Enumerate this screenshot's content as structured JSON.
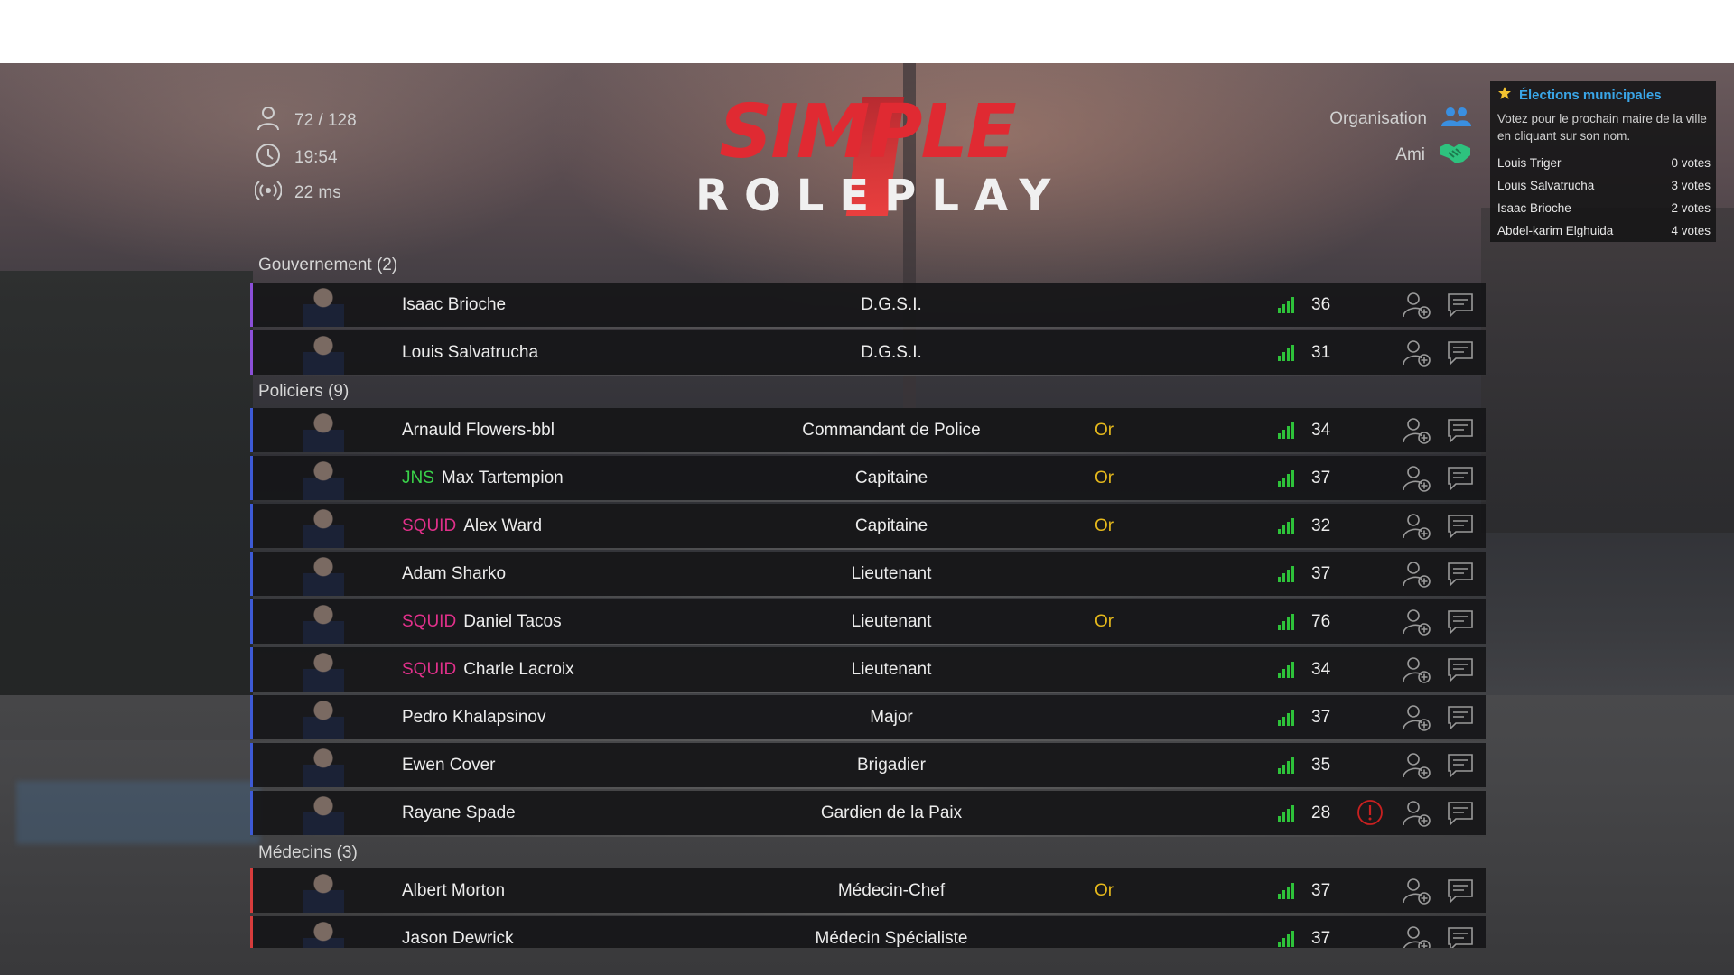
{
  "header": {
    "players": "72 / 128",
    "time": "19:54",
    "ping": "22 ms",
    "icons": {
      "players": "user-icon",
      "time": "clock-icon",
      "ping": "broadcast-icon"
    }
  },
  "logo": {
    "line1": "SIMPLE",
    "line2": "ROLEPLAY"
  },
  "legend": {
    "organisation": "Organisation",
    "ami": "Ami",
    "organisation_color": "#3a8fe0",
    "ami_color": "#2ec27e"
  },
  "elections": {
    "title": "Élections municipales",
    "description": "Votez pour le prochain maire de la ville en cliquant sur son nom.",
    "candidates": [
      {
        "name": "Louis Triger",
        "votes": "0 votes"
      },
      {
        "name": "Louis Salvatrucha",
        "votes": "3 votes"
      },
      {
        "name": "Isaac Brioche",
        "votes": "2 votes"
      },
      {
        "name": "Abdel-karim Elghuida",
        "votes": "4 votes"
      }
    ]
  },
  "colors": {
    "gouvernement": "#8b4fd8",
    "police": "#3d5ad6",
    "medecin": "#d63c3c",
    "rank_or": "#e6b91c",
    "tag_jns": "#3ad24a",
    "tag_squid": "#e0308a",
    "signal": "#2ec23a",
    "warn": "#c92020"
  },
  "sections": [
    {
      "title": "Gouvernement (2)",
      "players": [
        {
          "tag": "",
          "name": "Isaac Brioche",
          "grade": "D.G.S.I.",
          "rank": "",
          "ping": "36"
        },
        {
          "tag": "",
          "name": "Louis Salvatrucha",
          "grade": "D.G.S.I.",
          "rank": "",
          "ping": "31"
        }
      ]
    },
    {
      "title": "Policiers (9)",
      "players": [
        {
          "tag": "",
          "name": "Arnauld Flowers-bbl",
          "grade": "Commandant de Police",
          "rank": "Or",
          "ping": "34"
        },
        {
          "tag": "JNS",
          "name": "Max Tartempion",
          "grade": "Capitaine",
          "rank": "Or",
          "ping": "37"
        },
        {
          "tag": "SQUID",
          "name": "Alex Ward",
          "grade": "Capitaine",
          "rank": "Or",
          "ping": "32"
        },
        {
          "tag": "",
          "name": "Adam Sharko",
          "grade": "Lieutenant",
          "rank": "",
          "ping": "37"
        },
        {
          "tag": "SQUID",
          "name": "Daniel Tacos",
          "grade": "Lieutenant",
          "rank": "Or",
          "ping": "76"
        },
        {
          "tag": "SQUID",
          "name": "Charle Lacroix",
          "grade": "Lieutenant",
          "rank": "",
          "ping": "34"
        },
        {
          "tag": "",
          "name": "Pedro Khalapsinov",
          "grade": "Major",
          "rank": "",
          "ping": "37"
        },
        {
          "tag": "",
          "name": "Ewen Cover",
          "grade": "Brigadier",
          "rank": "",
          "ping": "35"
        },
        {
          "tag": "",
          "name": "Rayane Spade",
          "grade": "Gardien de la Paix",
          "rank": "",
          "ping": "28",
          "warning": true
        }
      ]
    },
    {
      "title": "Médecins (3)",
      "players": [
        {
          "tag": "",
          "name": "Albert Morton",
          "grade": "Médecin-Chef",
          "rank": "Or",
          "ping": "37"
        },
        {
          "tag": "",
          "name": "Jason Dewrick",
          "grade": "Médecin Spécialiste",
          "rank": "",
          "ping": "37"
        }
      ]
    }
  ],
  "row_icons": {
    "signal": "signal-bars-icon",
    "add_friend": "add-friend-icon",
    "message": "message-icon",
    "warning": "warning-icon"
  }
}
